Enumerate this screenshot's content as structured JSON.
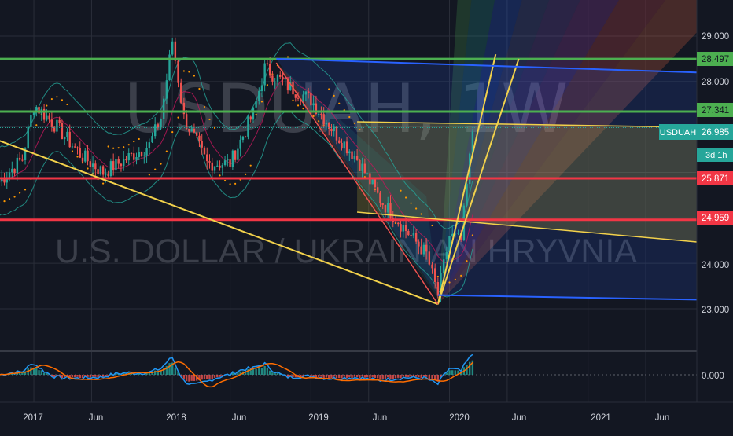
{
  "watermark": {
    "symbol_text": "USDUAH, 1W",
    "description_text": "U.S. DOLLAR / UKRAINIAN HRYVNIA"
  },
  "price_axis": {
    "ticks": [
      "29.000",
      "28.000",
      "24.000",
      "23.000"
    ],
    "tag_price": "26.985",
    "tag_symbol": "USDUAH",
    "countdown": "3d 1h"
  },
  "levels": [
    {
      "label": "28.497",
      "color": "#4caf50"
    },
    {
      "label": "27.341",
      "color": "#4caf50"
    },
    {
      "label": "25.871",
      "color": "#f23645"
    },
    {
      "label": "24.959",
      "color": "#f23645"
    }
  ],
  "time_axis": {
    "labels": [
      "2017",
      "Jun",
      "2018",
      "Jun",
      "2019",
      "Jun",
      "2020",
      "Jun",
      "2021",
      "Jun"
    ]
  },
  "macd": {
    "tick": "0.000"
  },
  "colors": {
    "background": "#131722",
    "grid": "#2a2e39",
    "axis_text": "#d1d4dc",
    "price_tag": "#26a69a",
    "up": "#26a69a",
    "down": "#ef5350",
    "trend": "#f2d14b",
    "channel": "#2962ff"
  },
  "chart_data": {
    "type": "candlestick",
    "symbol": "USDUAH",
    "interval": "1W",
    "y_scale": "linear",
    "ylim": [
      22.7,
      29.5
    ],
    "grid": true,
    "x_range": [
      "2016-10",
      "2021-09"
    ],
    "horizontal_levels": [
      28.497,
      27.341,
      25.871,
      24.959
    ],
    "last_price": 26.985,
    "price_path": [
      {
        "x": "2016-10",
        "y": 25.8
      },
      {
        "x": "2016-12",
        "y": 26.3
      },
      {
        "x": "2017-01",
        "y": 27.5
      },
      {
        "x": "2017-03",
        "y": 27.0
      },
      {
        "x": "2017-05",
        "y": 26.4
      },
      {
        "x": "2017-07",
        "y": 26.0
      },
      {
        "x": "2017-09",
        "y": 26.3
      },
      {
        "x": "2017-11",
        "y": 26.6
      },
      {
        "x": "2017-12",
        "y": 27.2
      },
      {
        "x": "2018-01",
        "y": 28.9
      },
      {
        "x": "2018-02",
        "y": 27.2
      },
      {
        "x": "2018-04",
        "y": 26.2
      },
      {
        "x": "2018-06",
        "y": 26.2
      },
      {
        "x": "2018-08",
        "y": 27.3
      },
      {
        "x": "2018-09",
        "y": 28.3
      },
      {
        "x": "2018-11",
        "y": 27.9
      },
      {
        "x": "2019-01",
        "y": 27.6
      },
      {
        "x": "2019-03",
        "y": 26.9
      },
      {
        "x": "2019-05",
        "y": 26.3
      },
      {
        "x": "2019-07",
        "y": 25.4
      },
      {
        "x": "2019-09",
        "y": 24.8
      },
      {
        "x": "2019-11",
        "y": 24.2
      },
      {
        "x": "2019-12",
        "y": 23.3
      },
      {
        "x": "2020-01",
        "y": 24.6
      },
      {
        "x": "2020-02",
        "y": 24.5
      },
      {
        "x": "2020-03",
        "y": 26.9
      }
    ],
    "drawings": {
      "fan_origin": {
        "x": "2019-12",
        "y": 23.1
      },
      "trend_lines": [
        {
          "from": {
            "x": "2016-10",
            "y": 26.7
          },
          "to": {
            "x": "2019-12",
            "y": 23.1
          }
        },
        {
          "from": {
            "x": "2019-12",
            "y": 23.1
          },
          "to": {
            "x": "2020-05",
            "y": 28.6
          }
        },
        {
          "from": {
            "x": "2019-12",
            "y": 23.1
          },
          "to": {
            "x": "2020-07",
            "y": 28.5
          }
        }
      ],
      "channel": {
        "top_left": {
          "x": "2018-10",
          "y": 28.5
        },
        "top_right": {
          "x": "2021-09",
          "y": 28.2
        },
        "bottom_left": {
          "x": "2019-12",
          "y": 23.3
        },
        "bottom_right": {
          "x": "2021-09",
          "y": 23.2
        }
      }
    },
    "macd": {
      "zero": 0.0
    }
  }
}
